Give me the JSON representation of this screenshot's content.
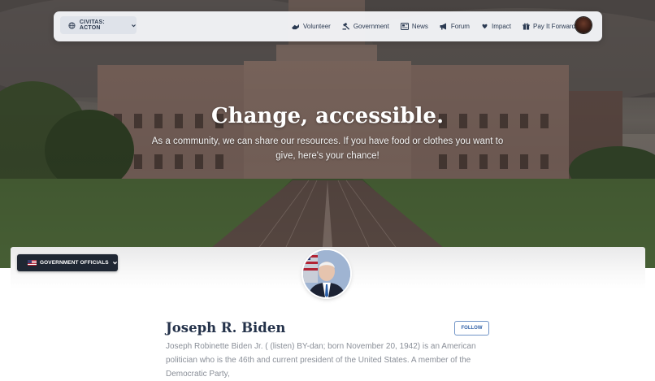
{
  "nav": {
    "location_label": "CIVITAS: ACTON",
    "links": [
      {
        "label": "Volunteer",
        "icon": "hands-icon"
      },
      {
        "label": "Government",
        "icon": "gavel-icon"
      },
      {
        "label": "News",
        "icon": "newspaper-icon"
      },
      {
        "label": "Forum",
        "icon": "megaphone-icon"
      },
      {
        "label": "Impact",
        "icon": "hand-heart-icon"
      },
      {
        "label": "Pay It Forward",
        "icon": "gift-icon"
      }
    ]
  },
  "hero": {
    "title": "Change, accessible.",
    "subtitle": "As a community, we can share our resources. If you have food or clothes you want to give, here's your chance!"
  },
  "officials": {
    "dropdown_label": "GOVERNMENT OFFICIALS",
    "name": "Joseph R. Biden",
    "follow_label": "FOLLOW",
    "bio": "Joseph Robinette Biden Jr. ( (listen) BY-dan; born November 20, 1942) is an American politician who is the 46th and current president of the United States. A member of the Democratic Party,"
  },
  "colors": {
    "navy_text": "#24324a",
    "dropdown_bg": "#1f2733",
    "follow_accent": "#2e5fa6"
  }
}
